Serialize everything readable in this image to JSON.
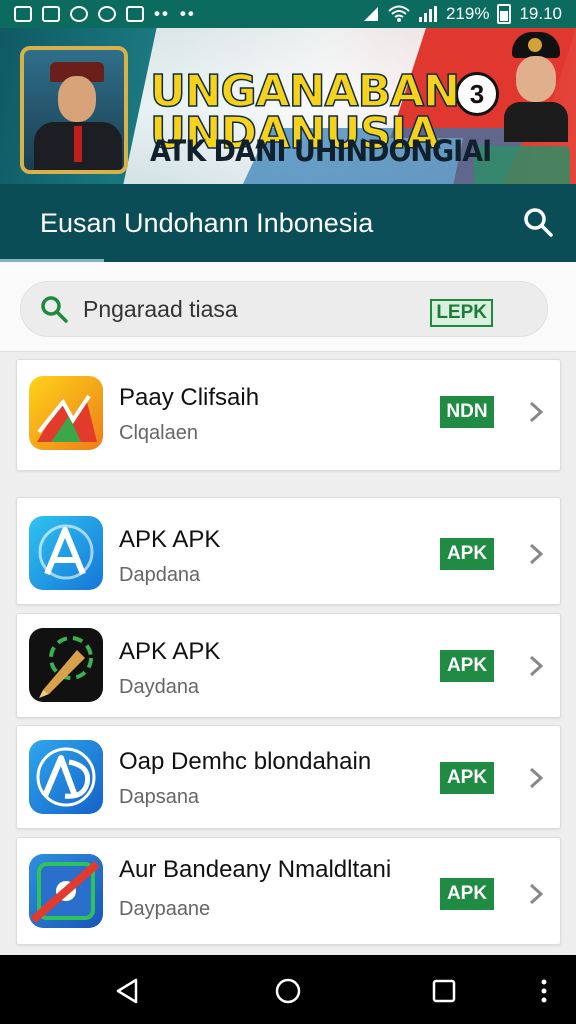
{
  "status_bar": {
    "right_text": "219%",
    "time": "19.10",
    "left_dots": "••",
    "left_dots2": "••",
    "signal_icon": "signal-icon",
    "wifi_icon": "wifi-icon"
  },
  "banner": {
    "title_line1": "UNGANABAN",
    "title_line2": "UNDANUSIA",
    "subtitle": "ATK DANI UHINDONGIAI",
    "badge_number": "3"
  },
  "appbar": {
    "title": "Eusan Undohann Inbonesia"
  },
  "search": {
    "placeholder": "Pngaraad tiasa",
    "tag": "LEPK"
  },
  "apps": [
    {
      "name": "Paay Clifsaih",
      "subtitle": "Clqalaen",
      "badge": "NDN"
    },
    {
      "name": "APK APK",
      "subtitle": "Dapdana",
      "badge": "APK"
    },
    {
      "name": "APK APK",
      "subtitle": "Daydana",
      "badge": "APK"
    },
    {
      "name": "Oap Demhc blondahain",
      "subtitle": "Dapsana",
      "badge": "APK"
    },
    {
      "name": "Aur Bandeany Nmaldltani",
      "subtitle": "Daypaane",
      "badge": "APK"
    }
  ],
  "colors": {
    "status_bar": "#0b6b5f",
    "appbar": "#0a4d57",
    "badge_green": "#1f8b43",
    "banner_yellow": "#f7d21c"
  }
}
